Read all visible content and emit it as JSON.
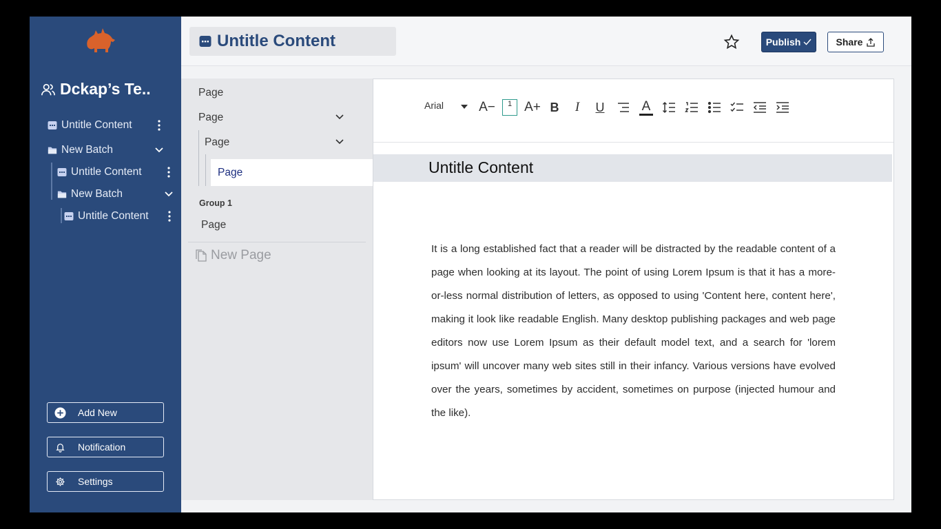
{
  "sidebar": {
    "team_name": "Dckap’s Te..",
    "tree": [
      {
        "label": "Untitle Content",
        "type": "content"
      },
      {
        "label": "New Batch",
        "type": "batch"
      },
      {
        "label": "Untitle Content",
        "type": "content"
      },
      {
        "label": "New Batch",
        "type": "batch"
      },
      {
        "label": "Untitle Content",
        "type": "content"
      }
    ],
    "buttons": {
      "add_new": "Add New",
      "notification": "Notification",
      "settings": "Settings"
    }
  },
  "header": {
    "title": "Untitle Content",
    "publish": "Publish",
    "share": "Share"
  },
  "pages": {
    "items": [
      "Page",
      "Page",
      "Page",
      "Page"
    ],
    "group_label": "Group 1",
    "group_items": [
      "Page"
    ],
    "new_page": "New Page"
  },
  "editor": {
    "font": "Arial",
    "font_size": "1",
    "toolbar_labels": {
      "decrease": "A−",
      "increase": "A+",
      "bold": "B",
      "italic": "I",
      "underline": "U",
      "color": "A"
    },
    "doc_title": "Untitle Content",
    "body": "It is a long established fact that a reader will be distracted by the readable content of a page when looking at its layout. The point of using Lorem Ipsum is that it has a more-or-less normal distribution of letters, as opposed to using 'Content here, content here', making it look like readable English. Many desktop publishing packages and web page editors now use Lorem Ipsum as their default model text, and a search for 'lorem ipsum' will uncover many web sites still in their infancy. Various versions have evolved over the years, sometimes by accident, sometimes on purpose (injected humour and the like)."
  },
  "colors": {
    "sidebar": "#2a4a7b",
    "accent": "#2a4a7b",
    "logo": "#d9622b",
    "size_box": "#2e9a8c"
  }
}
